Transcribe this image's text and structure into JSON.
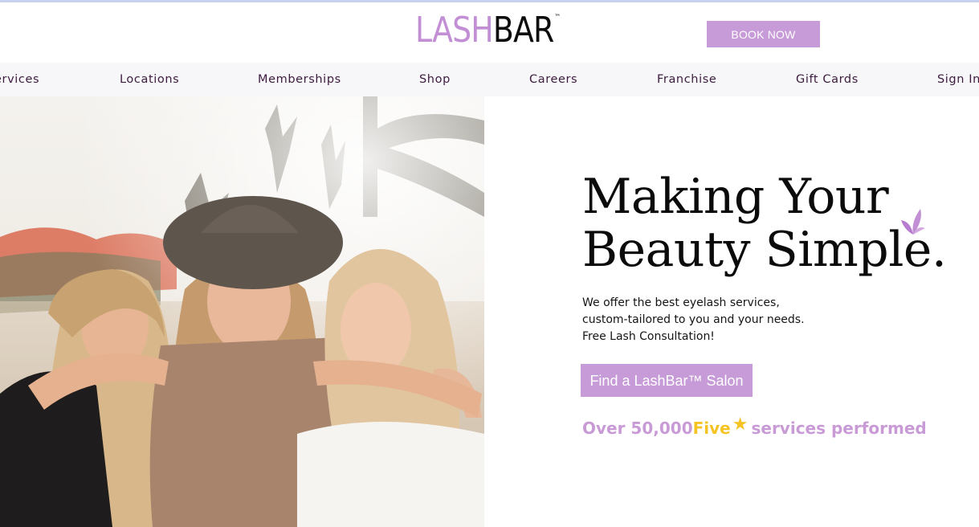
{
  "header": {
    "logo": {
      "part1": "LASH",
      "part2": "BAR",
      "tm": "™"
    },
    "book_button": "BOOK NOW"
  },
  "nav": {
    "items": [
      "ervices",
      "Locations",
      "Memberships",
      "Shop",
      "Careers",
      "Franchise",
      "Gift Cards",
      "Sign In"
    ]
  },
  "hero": {
    "headline_line1": "Making Your",
    "headline_line2": "Beauty Simple.",
    "description_lines": [
      "We offer the best eyelash services,",
      "custom-tailored to you and your needs.",
      "Free Lash Consultation!"
    ],
    "cta_button": "Find a LashBar™ Salon",
    "stat": {
      "prefix": "Over 50,000 ",
      "highlight": "Five",
      "suffix": " services performed"
    }
  },
  "colors": {
    "brand_purple": "#c79ad8",
    "dark_text": "#3d1b3f",
    "gold": "#f5c323"
  },
  "icons": {
    "decor": "butterfly-icon",
    "rating": "star-icon"
  }
}
